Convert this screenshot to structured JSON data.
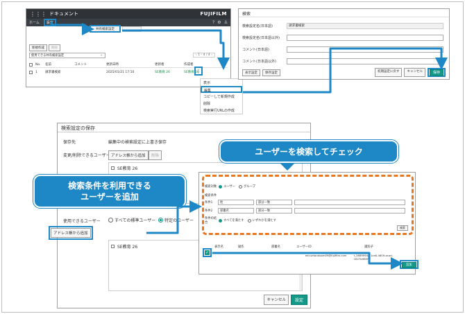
{
  "panel1": {
    "app_title": "ドキュメント",
    "brand": "FUJIFILM",
    "nav": {
      "home": "ホーム",
      "settings": "設定"
    },
    "shared_button": "共有検索設定",
    "toolbar": {
      "new_button": "新規作成",
      "delete_button": "削除"
    },
    "select_value": "使用できる共有検索設定",
    "pager": "1 - 4 / 4",
    "columns": [
      "No.",
      "名前",
      "コメント",
      "更新日時",
      "更新者",
      "作成者"
    ],
    "row": {
      "no": "1",
      "name": "請求書検索",
      "comment": "",
      "updated": "2025/01/21 17:10",
      "updater": "SE教育 26",
      "creator": "SE教育 26"
    },
    "more_icon": "more-dots-icon"
  },
  "menu": {
    "items": [
      "表示",
      "編集",
      "コピーして新規作成",
      "削除",
      "検索実行URLの作成"
    ],
    "highlighted_index": 1
  },
  "panel2": {
    "title": "検索",
    "fields": [
      {
        "label": "検索設定名(日本語)",
        "value": "請求書検索",
        "readonly": true
      },
      {
        "label": "検索設定名(日本語以外)",
        "value": "",
        "readonly": false
      },
      {
        "label": "コメント(日本語)",
        "value": "",
        "readonly": false
      },
      {
        "label": "コメント(日本語以外)",
        "value": "",
        "readonly": false
      }
    ],
    "buttons": {
      "show_settings": "表示設定",
      "save_settings": "保存設定",
      "reset": "初期設定に戻す",
      "cancel": "キャンセル",
      "save": "保存"
    }
  },
  "panel3": {
    "title": "検索設定の保存",
    "save_to_label": "保存先",
    "save_to_value": "編集中の検索設定に上書き保存",
    "editors_label": "変更/削除できるユーザー",
    "add_from_address": "アドレス帳から追加",
    "remove": "削除",
    "user1": "SE教育 26",
    "usable_label": "使用できるユーザー",
    "radio_all": "すべての標準ユーザー",
    "radio_specific": "特定のユーザー",
    "user2": "SE教育 26",
    "cancel": "キャンセル",
    "set": "設定"
  },
  "panel4": {
    "target_label": "検索対象",
    "target_user": "ユーザー",
    "target_group": "グループ",
    "conditions_label": "検索条件",
    "cond1_label": "条件1",
    "cond1_field": "姓",
    "cond1_op": "部分一致",
    "cond2_label": "条件2",
    "cond2_field": "部署名",
    "cond2_op": "部分一致",
    "match_label": "条件の結合",
    "match_all": "すべてを満たす",
    "match_any": "いずれかを満たす",
    "search_button": "検索",
    "columns": [
      "表示名",
      "操作",
      "部署名",
      "ユーザーID",
      "識別子"
    ],
    "result": {
      "email": "edr-setandoom09@fujifilm.com",
      "id": "t_5689994d-1ce6-4609-acad-1827b985fcf"
    },
    "set_button": "追加"
  },
  "callouts": {
    "search_check": "ユーザーを検索してチェック",
    "add_users_line1": "検索条件を利用できる",
    "add_users_line2": "ユーザーを追加"
  },
  "colors": {
    "accent": "#1e88c7",
    "teal": "#129988",
    "orange": "#e87722"
  }
}
